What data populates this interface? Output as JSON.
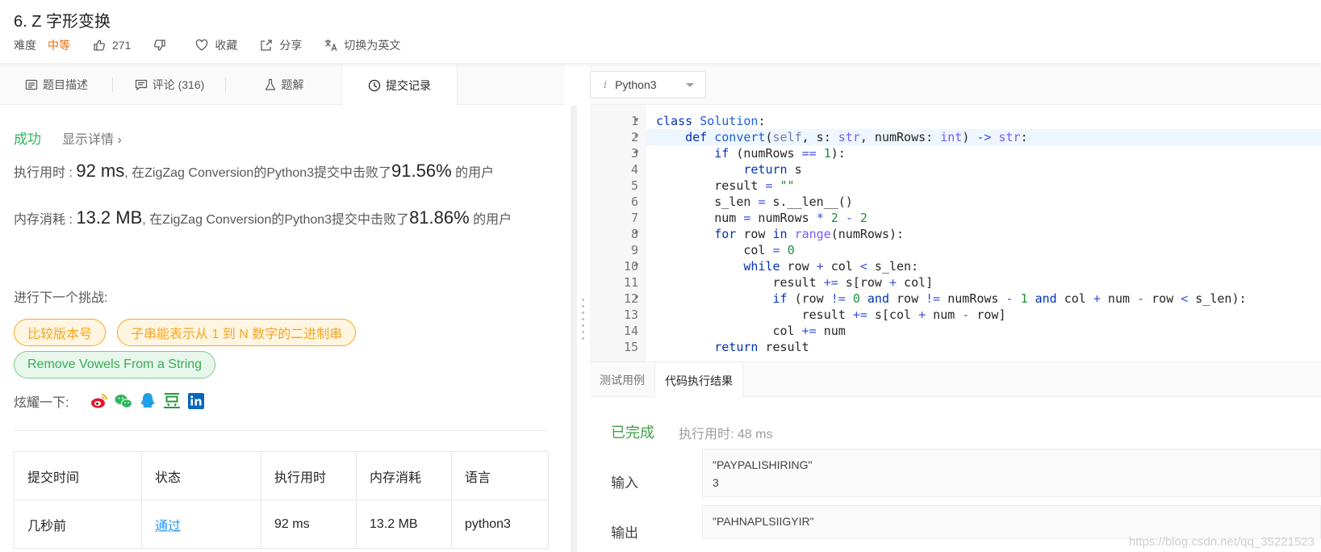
{
  "problem": {
    "title": "6. Z 字形变换",
    "difficulty_label": "难度",
    "difficulty": "中等",
    "likes": "271",
    "favorite_label": "收藏",
    "share_label": "分享",
    "switch_label": "切换为英文"
  },
  "tabs": [
    {
      "label": "题目描述",
      "icon": "description-icon"
    },
    {
      "label": "评论 (316)",
      "icon": "comment-icon"
    },
    {
      "label": "题解",
      "icon": "flask-icon"
    },
    {
      "label": "提交记录",
      "icon": "clock-icon"
    }
  ],
  "submission": {
    "status": "成功",
    "detail_link": "显示详情",
    "detail_chevron": "›",
    "runtime_prefix": "执行用时 : ",
    "runtime_value": "92 ms",
    "runtime_suffix": ", 在ZigZag Conversion的Python3提交中击败了",
    "runtime_pct": "91.56%",
    "runtime_tail": " 的用户",
    "memory_prefix": "内存消耗 : ",
    "memory_value": "13.2 MB",
    "memory_suffix": ", 在ZigZag Conversion的Python3提交中击败了",
    "memory_pct": "81.86%",
    "memory_tail": " 的用户",
    "next_challenge": "进行下一个挑战:",
    "challenges": [
      "比较版本号",
      "子串能表示从 1 到 N 数字的二进制串",
      "Remove Vowels From a String"
    ],
    "share_label": "炫耀一下:"
  },
  "table": {
    "headers": [
      "提交时间",
      "状态",
      "执行用时",
      "内存消耗",
      "语言"
    ],
    "rows": [
      [
        "几秒前",
        "通过",
        "92 ms",
        "13.2 MB",
        "python3"
      ]
    ]
  },
  "editor": {
    "language": "Python3",
    "language_icon_glyph": "i",
    "line_numbers": [
      "1",
      "2",
      "3",
      "4",
      "5",
      "6",
      "7",
      "8",
      "9",
      "10",
      "11",
      "12",
      "13",
      "14",
      "15"
    ]
  },
  "console": {
    "tabs": [
      "测试用例",
      "代码执行结果"
    ],
    "status": "已完成",
    "runtime": "执行用时: 48 ms",
    "input_label": "输入",
    "input_value": "\"PAYPALISHIRING\"\n3",
    "output_label": "输出",
    "output_value": "\"PAHNAPLSIIGYIR\""
  },
  "watermark": "https://blog.csdn.net/qq_35221523",
  "colors": {
    "accent_orange": "#ef6c00",
    "success_green": "#2db55d",
    "link_blue": "#2196f3"
  }
}
